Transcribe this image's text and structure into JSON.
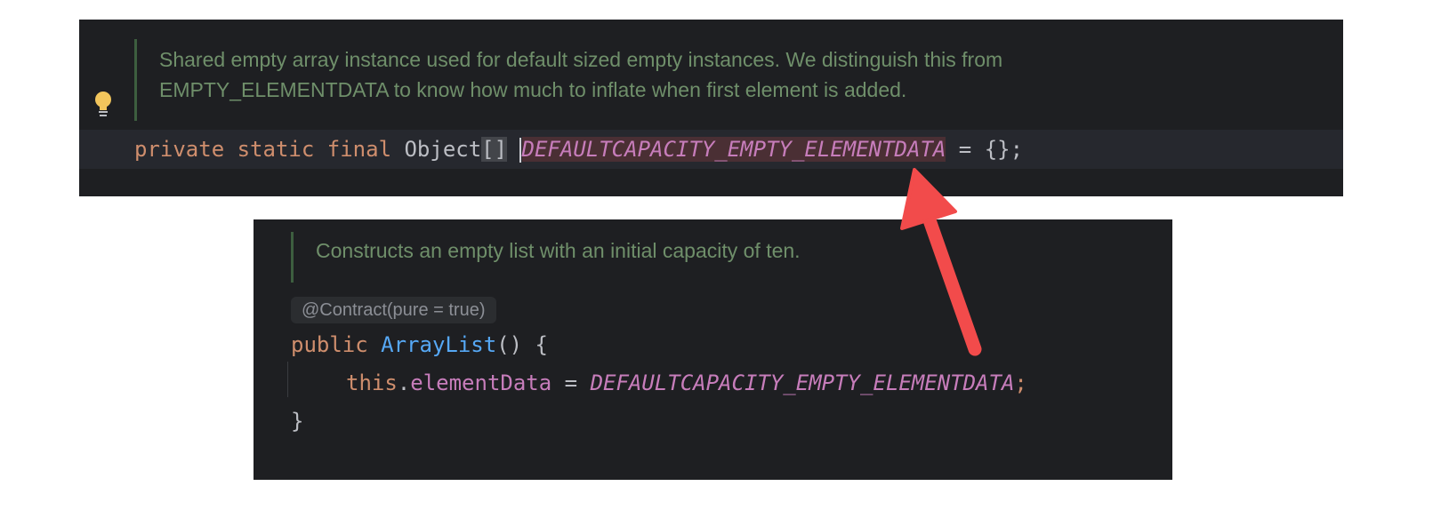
{
  "top_panel": {
    "doc_line1": "Shared empty array instance used for default sized empty instances. We distinguish this from",
    "doc_line2": "EMPTY_ELEMENTDATA to know how much to inflate when first element is added.",
    "code": {
      "kw_private": "private",
      "kw_static": "static",
      "kw_final": "final",
      "type": "Object",
      "brackets": "[]",
      "constant": "DEFAULTCAPACITY_EMPTY_ELEMENTDATA",
      "assign": " = {};"
    }
  },
  "bottom_panel": {
    "doc_line": "Constructs an empty list with an initial capacity of ten.",
    "annotation": "@Contract(pure = true)",
    "line1": {
      "kw_public": "public",
      "method": "ArrayList",
      "rest": "() {"
    },
    "line2": {
      "kw_this": "this",
      "dot": ".",
      "field": "elementData",
      "assign": " = ",
      "constant": "DEFAULTCAPACITY_EMPTY_ELEMENTDATA",
      "semi": ";"
    },
    "line3": "}"
  },
  "colors": {
    "panel_bg": "#1e1f22",
    "keyword": "#cf8e6d",
    "constant": "#c77dbb",
    "method": "#56a8f5",
    "doc_comment": "#6f8f6a",
    "arrow": "#f24b4b"
  },
  "icons": {
    "bulb": "lightbulb-icon",
    "arrow": "red-arrow"
  }
}
